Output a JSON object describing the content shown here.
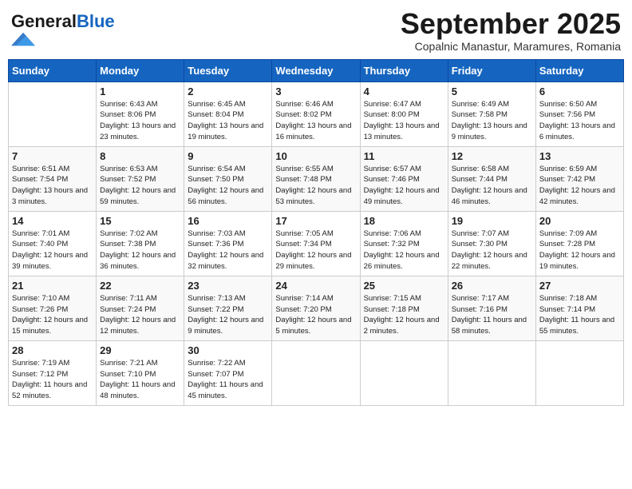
{
  "header": {
    "logo_general": "General",
    "logo_blue": "Blue",
    "month": "September 2025",
    "location": "Copalnic Manastur, Maramures, Romania"
  },
  "days_of_week": [
    "Sunday",
    "Monday",
    "Tuesday",
    "Wednesday",
    "Thursday",
    "Friday",
    "Saturday"
  ],
  "weeks": [
    [
      {
        "day": "",
        "info": ""
      },
      {
        "day": "1",
        "info": "Sunrise: 6:43 AM\nSunset: 8:06 PM\nDaylight: 13 hours and 23 minutes."
      },
      {
        "day": "2",
        "info": "Sunrise: 6:45 AM\nSunset: 8:04 PM\nDaylight: 13 hours and 19 minutes."
      },
      {
        "day": "3",
        "info": "Sunrise: 6:46 AM\nSunset: 8:02 PM\nDaylight: 13 hours and 16 minutes."
      },
      {
        "day": "4",
        "info": "Sunrise: 6:47 AM\nSunset: 8:00 PM\nDaylight: 13 hours and 13 minutes."
      },
      {
        "day": "5",
        "info": "Sunrise: 6:49 AM\nSunset: 7:58 PM\nDaylight: 13 hours and 9 minutes."
      },
      {
        "day": "6",
        "info": "Sunrise: 6:50 AM\nSunset: 7:56 PM\nDaylight: 13 hours and 6 minutes."
      }
    ],
    [
      {
        "day": "7",
        "info": "Sunrise: 6:51 AM\nSunset: 7:54 PM\nDaylight: 13 hours and 3 minutes."
      },
      {
        "day": "8",
        "info": "Sunrise: 6:53 AM\nSunset: 7:52 PM\nDaylight: 12 hours and 59 minutes."
      },
      {
        "day": "9",
        "info": "Sunrise: 6:54 AM\nSunset: 7:50 PM\nDaylight: 12 hours and 56 minutes."
      },
      {
        "day": "10",
        "info": "Sunrise: 6:55 AM\nSunset: 7:48 PM\nDaylight: 12 hours and 53 minutes."
      },
      {
        "day": "11",
        "info": "Sunrise: 6:57 AM\nSunset: 7:46 PM\nDaylight: 12 hours and 49 minutes."
      },
      {
        "day": "12",
        "info": "Sunrise: 6:58 AM\nSunset: 7:44 PM\nDaylight: 12 hours and 46 minutes."
      },
      {
        "day": "13",
        "info": "Sunrise: 6:59 AM\nSunset: 7:42 PM\nDaylight: 12 hours and 42 minutes."
      }
    ],
    [
      {
        "day": "14",
        "info": "Sunrise: 7:01 AM\nSunset: 7:40 PM\nDaylight: 12 hours and 39 minutes."
      },
      {
        "day": "15",
        "info": "Sunrise: 7:02 AM\nSunset: 7:38 PM\nDaylight: 12 hours and 36 minutes."
      },
      {
        "day": "16",
        "info": "Sunrise: 7:03 AM\nSunset: 7:36 PM\nDaylight: 12 hours and 32 minutes."
      },
      {
        "day": "17",
        "info": "Sunrise: 7:05 AM\nSunset: 7:34 PM\nDaylight: 12 hours and 29 minutes."
      },
      {
        "day": "18",
        "info": "Sunrise: 7:06 AM\nSunset: 7:32 PM\nDaylight: 12 hours and 26 minutes."
      },
      {
        "day": "19",
        "info": "Sunrise: 7:07 AM\nSunset: 7:30 PM\nDaylight: 12 hours and 22 minutes."
      },
      {
        "day": "20",
        "info": "Sunrise: 7:09 AM\nSunset: 7:28 PM\nDaylight: 12 hours and 19 minutes."
      }
    ],
    [
      {
        "day": "21",
        "info": "Sunrise: 7:10 AM\nSunset: 7:26 PM\nDaylight: 12 hours and 15 minutes."
      },
      {
        "day": "22",
        "info": "Sunrise: 7:11 AM\nSunset: 7:24 PM\nDaylight: 12 hours and 12 minutes."
      },
      {
        "day": "23",
        "info": "Sunrise: 7:13 AM\nSunset: 7:22 PM\nDaylight: 12 hours and 9 minutes."
      },
      {
        "day": "24",
        "info": "Sunrise: 7:14 AM\nSunset: 7:20 PM\nDaylight: 12 hours and 5 minutes."
      },
      {
        "day": "25",
        "info": "Sunrise: 7:15 AM\nSunset: 7:18 PM\nDaylight: 12 hours and 2 minutes."
      },
      {
        "day": "26",
        "info": "Sunrise: 7:17 AM\nSunset: 7:16 PM\nDaylight: 11 hours and 58 minutes."
      },
      {
        "day": "27",
        "info": "Sunrise: 7:18 AM\nSunset: 7:14 PM\nDaylight: 11 hours and 55 minutes."
      }
    ],
    [
      {
        "day": "28",
        "info": "Sunrise: 7:19 AM\nSunset: 7:12 PM\nDaylight: 11 hours and 52 minutes."
      },
      {
        "day": "29",
        "info": "Sunrise: 7:21 AM\nSunset: 7:10 PM\nDaylight: 11 hours and 48 minutes."
      },
      {
        "day": "30",
        "info": "Sunrise: 7:22 AM\nSunset: 7:07 PM\nDaylight: 11 hours and 45 minutes."
      },
      {
        "day": "",
        "info": ""
      },
      {
        "day": "",
        "info": ""
      },
      {
        "day": "",
        "info": ""
      },
      {
        "day": "",
        "info": ""
      }
    ]
  ]
}
